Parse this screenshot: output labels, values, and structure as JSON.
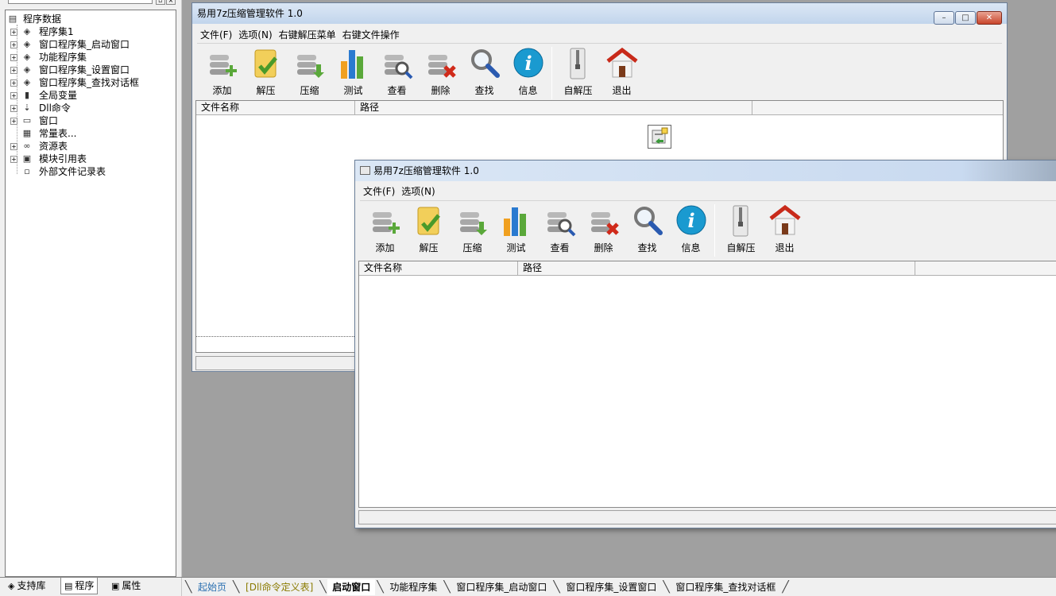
{
  "left_panel": {
    "tree": [
      {
        "label": "程序数据",
        "icon": "data-icon",
        "level": 0,
        "expander": ""
      },
      {
        "label": "程序集1",
        "icon": "module-icon",
        "level": 1,
        "expander": "+"
      },
      {
        "label": "窗口程序集_启动窗口",
        "icon": "module-icon",
        "level": 1,
        "expander": "+"
      },
      {
        "label": "功能程序集",
        "icon": "module-icon",
        "level": 1,
        "expander": "+"
      },
      {
        "label": "窗口程序集_设置窗口",
        "icon": "module-icon",
        "level": 1,
        "expander": "+"
      },
      {
        "label": "窗口程序集_查找对话框",
        "icon": "module-icon",
        "level": 1,
        "expander": "+"
      },
      {
        "label": "全局变量",
        "icon": "variable-icon",
        "level": 1,
        "expander": "+"
      },
      {
        "label": "Dll命令",
        "icon": "dll-icon",
        "level": 1,
        "expander": "+"
      },
      {
        "label": "窗口",
        "icon": "window-icon",
        "level": 1,
        "expander": "+"
      },
      {
        "label": "常量表...",
        "icon": "constant-icon",
        "level": 1,
        "expander": ""
      },
      {
        "label": "资源表",
        "icon": "resource-icon",
        "level": 1,
        "expander": "+"
      },
      {
        "label": "模块引用表",
        "icon": "module-ref-icon",
        "level": 1,
        "expander": "+"
      },
      {
        "label": "外部文件记录表",
        "icon": "file-record-icon",
        "level": 1,
        "expander": ""
      }
    ],
    "tabs": [
      {
        "label": "支持库",
        "icon": "library-icon"
      },
      {
        "label": "程序",
        "icon": "program-icon"
      },
      {
        "label": "属性",
        "icon": "property-icon"
      }
    ]
  },
  "back_window": {
    "title": "易用7z压缩管理软件 1.0",
    "menu": [
      "文件(F)",
      "选项(N)",
      "右键解压菜单",
      "右键文件操作"
    ],
    "toolbar": [
      {
        "label": "添加",
        "icon": "add-icon"
      },
      {
        "label": "解压",
        "icon": "extract-icon"
      },
      {
        "label": "压缩",
        "icon": "compress-icon"
      },
      {
        "label": "测试",
        "icon": "test-icon"
      },
      {
        "label": "查看",
        "icon": "view-icon"
      },
      {
        "label": "删除",
        "icon": "delete-icon"
      },
      {
        "label": "查找",
        "icon": "find-icon"
      },
      {
        "label": "信息",
        "icon": "info-icon"
      },
      {
        "label": "自解压",
        "icon": "sfx-icon"
      },
      {
        "label": "退出",
        "icon": "exit-icon"
      }
    ],
    "columns": [
      "文件名称",
      "路径"
    ]
  },
  "front_window": {
    "title": "易用7z压缩管理软件 1.0",
    "menu": [
      "文件(F)",
      "选项(N)"
    ],
    "toolbar": [
      {
        "label": "添加",
        "icon": "add-icon"
      },
      {
        "label": "解压",
        "icon": "extract-icon"
      },
      {
        "label": "压缩",
        "icon": "compress-icon"
      },
      {
        "label": "测试",
        "icon": "test-icon"
      },
      {
        "label": "查看",
        "icon": "view-icon"
      },
      {
        "label": "删除",
        "icon": "delete-icon"
      },
      {
        "label": "查找",
        "icon": "find-icon"
      },
      {
        "label": "信息",
        "icon": "info-icon"
      },
      {
        "label": "自解压",
        "icon": "sfx-icon"
      },
      {
        "label": "退出",
        "icon": "exit-icon"
      }
    ],
    "columns": [
      "文件名称",
      "路径"
    ]
  },
  "doc_tabs": [
    {
      "label": "起始页",
      "color": "#2a6fb0",
      "selected": false
    },
    {
      "label": "[Dll命令定义表]",
      "color": "#8a7a00",
      "selected": false
    },
    {
      "label": "启动窗口",
      "color": "#000000",
      "selected": true
    },
    {
      "label": "功能程序集",
      "color": "#000000",
      "selected": false
    },
    {
      "label": "窗口程序集_启动窗口",
      "color": "#000000",
      "selected": false
    },
    {
      "label": "窗口程序集_设置窗口",
      "color": "#000000",
      "selected": false
    },
    {
      "label": "窗口程序集_查找对话框",
      "color": "#000000",
      "selected": false
    }
  ]
}
